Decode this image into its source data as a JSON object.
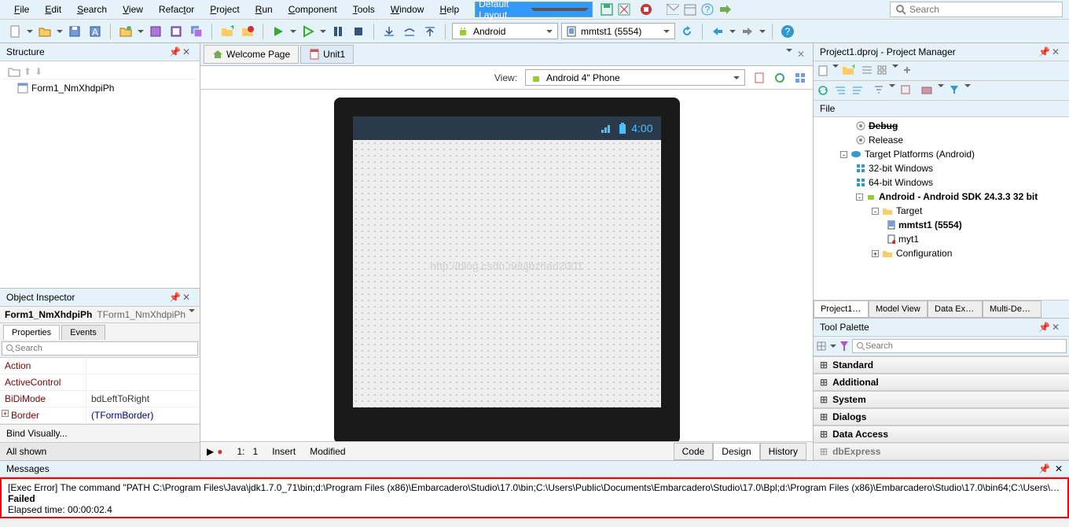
{
  "menu": {
    "file": "File",
    "edit": "Edit",
    "search": "Search",
    "view": "View",
    "refactor": "Refactor",
    "project": "Project",
    "run": "Run",
    "component": "Component",
    "tools": "Tools",
    "window": "Window",
    "help": "Help"
  },
  "layout_combo": "Default Layout",
  "search_placeholder": "Search",
  "toolbar": {
    "platform": "Android",
    "device": "mmtst1 (5554)"
  },
  "structure": {
    "title": "Structure",
    "tree_item": "Form1_NmXhdpiPh"
  },
  "object_inspector": {
    "title": "Object Inspector",
    "selected_name": "Form1_NmXhdpiPh",
    "selected_type": "TForm1_NmXhdpiPh",
    "tabs": {
      "properties": "Properties",
      "events": "Events"
    },
    "search_placeholder": "Search",
    "rows": [
      {
        "k": "Action",
        "v": ""
      },
      {
        "k": "ActiveControl",
        "v": ""
      },
      {
        "k": "BiDiMode",
        "v": "bdLeftToRight"
      },
      {
        "k": "Border",
        "v": "(TFormBorder)"
      }
    ],
    "bind_visually": "Bind Visually...",
    "all_shown": "All shown"
  },
  "editor": {
    "welcome_tab": "Welcome Page",
    "unit_tab": "Unit1",
    "view_label": "View:",
    "view_device": "Android 4\" Phone",
    "status_time": "4:00",
    "watermark": "http://blog.csdn.net/jhzhao2001",
    "status_strip": {
      "line": "1:",
      "col": "1",
      "mode": "Insert",
      "modified": "Modified",
      "tabs": {
        "code": "Code",
        "design": "Design",
        "history": "History"
      }
    }
  },
  "project_manager": {
    "title": "Project1.dproj - Project Manager",
    "file_label": "File",
    "tree": {
      "debug": "Debug",
      "release": "Release",
      "target_platforms": "Target Platforms (Android)",
      "win32": "32-bit Windows",
      "win64": "64-bit Windows",
      "android": "Android - Android SDK 24.3.3 32 bit",
      "target": "Target",
      "mmtst1": "mmtst1 (5554)",
      "myt1": "myt1",
      "configuration": "Configuration"
    },
    "bottom_tabs": {
      "project": "Project1.d...",
      "model": "Model View",
      "data": "Data Expl...",
      "multi": "Multi-Devi..."
    }
  },
  "tool_palette": {
    "title": "Tool Palette",
    "search_placeholder": "Search",
    "categories": [
      "Standard",
      "Additional",
      "System",
      "Dialogs",
      "Data Access",
      "dbExpress"
    ]
  },
  "messages": {
    "title": "Messages",
    "error_line": "[Exec Error] The command \"PATH C:\\Program Files\\Java\\jdk1.7.0_71\\bin;d:\\Program Files (x86)\\Embarcadero\\Studio\\17.0\\bin;C:\\Users\\Public\\Documents\\Embarcadero\\Studio\\17.0\\Bpl;d:\\Program Files (x86)\\Embarcadero\\Studio\\17.0\\bin64;C:\\Users\\Public\\Documents\\Embarc...",
    "failed": "Failed",
    "elapsed": "Elapsed time: 00:00:02.4"
  }
}
